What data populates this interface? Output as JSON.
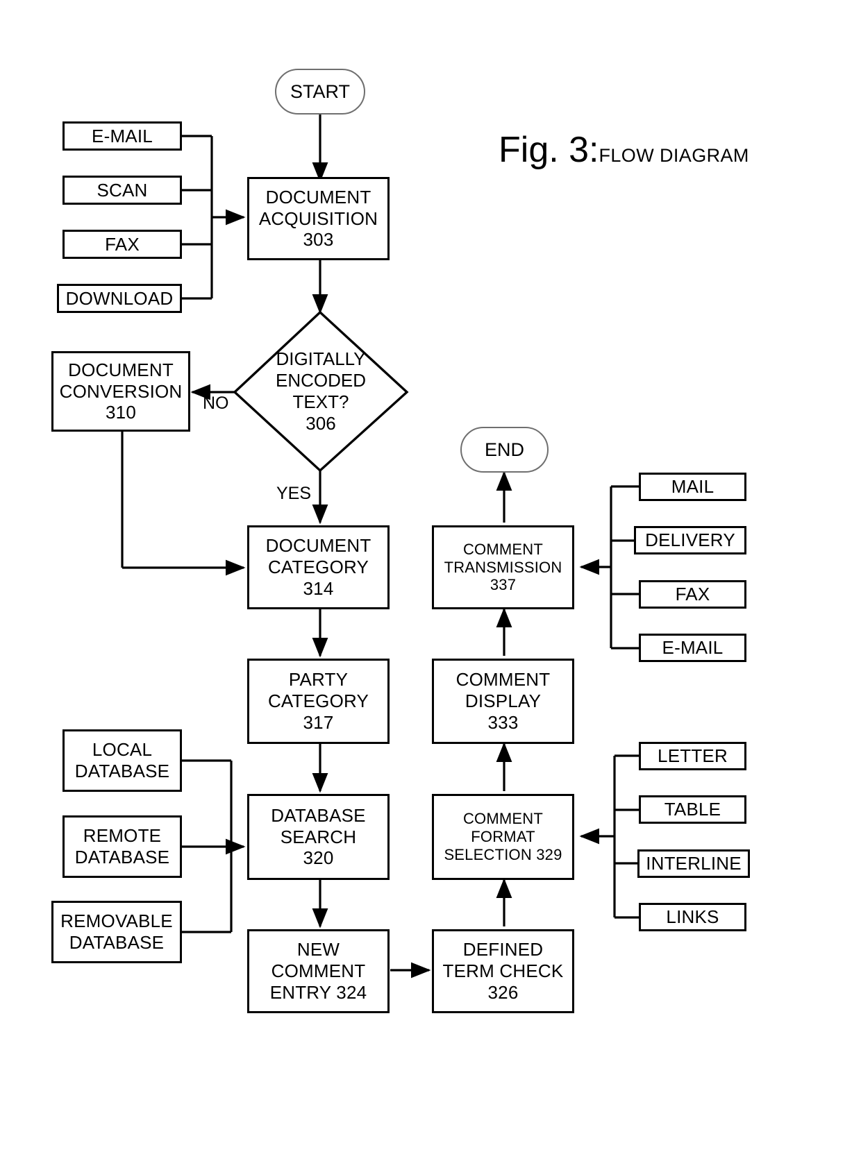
{
  "title": {
    "figure_label": "Fig. 3:",
    "caption": "FLOW DIAGRAM"
  },
  "terminators": {
    "start": "START",
    "end": "END"
  },
  "edge_labels": {
    "no": "NO",
    "yes": "YES"
  },
  "acquisition_sources": [
    {
      "label": "E-MAIL"
    },
    {
      "label": "SCAN"
    },
    {
      "label": "FAX"
    },
    {
      "label": "DOWNLOAD"
    }
  ],
  "database_sources": [
    {
      "label": "LOCAL\nDATABASE"
    },
    {
      "label": "REMOTE\nDATABASE"
    },
    {
      "label": "REMOVABLE\nDATABASE"
    }
  ],
  "transmission_methods": [
    {
      "label": "MAIL"
    },
    {
      "label": "DELIVERY"
    },
    {
      "label": "FAX"
    },
    {
      "label": "E-MAIL"
    }
  ],
  "format_options": [
    {
      "label": "LETTER"
    },
    {
      "label": "TABLE"
    },
    {
      "label": "INTERLINE"
    },
    {
      "label": "LINKS"
    }
  ],
  "process_nodes": {
    "document_acquisition": "DOCUMENT\nACQUISITION\n303",
    "digitally_encoded_text": "DIGITALLY\nENCODED\nTEXT?\n306",
    "document_conversion": "DOCUMENT\nCONVERSION\n310",
    "document_category": "DOCUMENT\nCATEGORY\n314",
    "party_category": "PARTY\nCATEGORY\n317",
    "database_search": "DATABASE\nSEARCH\n320",
    "new_comment_entry": "NEW\nCOMMENT\nENTRY 324",
    "defined_term_check": "DEFINED\nTERM CHECK\n326",
    "comment_format_selection": "COMMENT\nFORMAT\nSELECTION 329",
    "comment_display": "COMMENT\nDISPLAY\n333",
    "comment_transmission": "COMMENT\nTRANSMISSION\n337"
  },
  "colors": {
    "stroke": "#000000",
    "terminator_stroke": "#6f6f6f",
    "background": "#ffffff"
  }
}
